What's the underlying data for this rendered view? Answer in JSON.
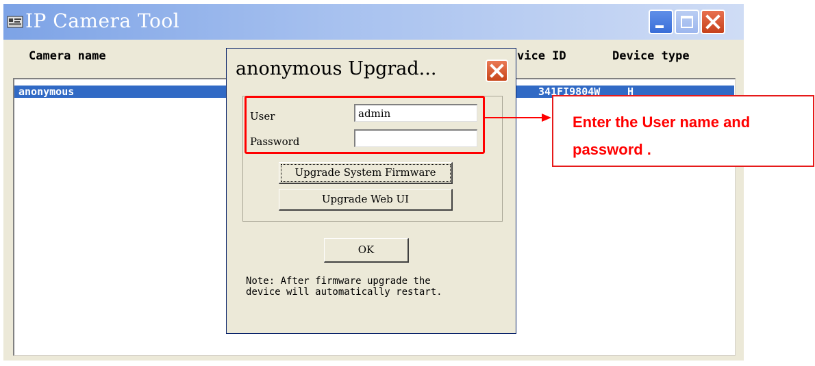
{
  "window": {
    "title": "IP Camera Tool",
    "icon": "app-icon",
    "controls": [
      "minimize",
      "maximize",
      "close"
    ]
  },
  "columns": {
    "camera_name": "Camera name",
    "device_id": "vice ID",
    "device_type": "Device type"
  },
  "rows": [
    {
      "camera_name": "anonymous",
      "device_id": "341FI9804W",
      "device_type": "H",
      "selected": true
    }
  ],
  "dialog": {
    "title": "anonymous Upgrad...",
    "user_label": "User",
    "user_value": "admin",
    "password_label": "Password",
    "password_value": "",
    "upgrade_firmware_label": "Upgrade System Firmware",
    "upgrade_webui_label": "Upgrade Web UI",
    "ok_label": "OK",
    "note_line1": "Note: After firmware upgrade the",
    "note_line2": "device will automatically restart."
  },
  "annotation": {
    "text": "Enter the User name and password .",
    "color": "#ff0000"
  },
  "colors": {
    "selection": "#316ac5",
    "title_gradient_start": "#7da3e6",
    "title_gradient_end": "#cfdcf5",
    "window_bg": "#ece9d8"
  }
}
